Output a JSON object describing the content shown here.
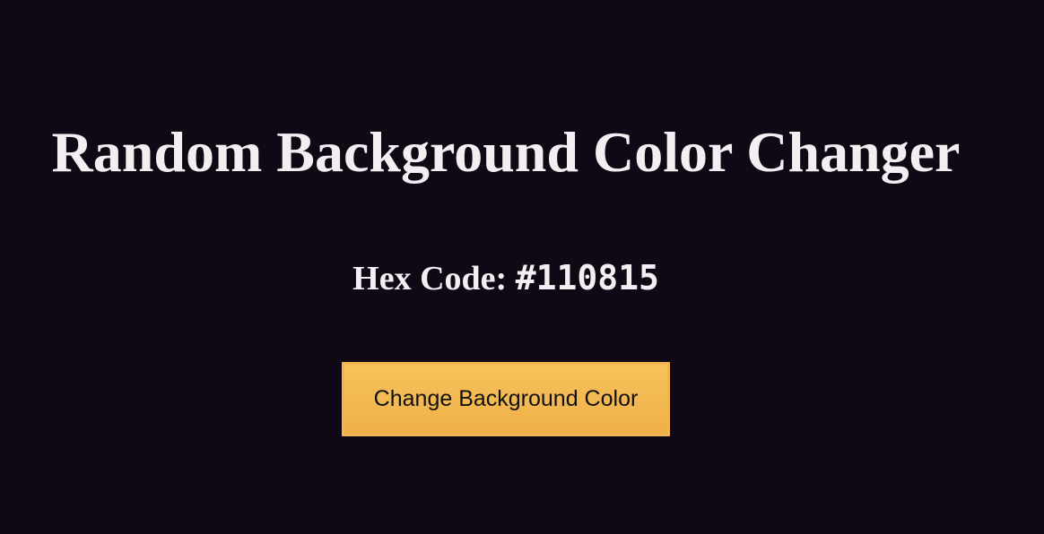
{
  "page": {
    "title": "Random Background Color Changer",
    "background_color": "#110815",
    "text_color": "#f2eef2"
  },
  "hex": {
    "label": "Hex Code:",
    "value": "#110815"
  },
  "button": {
    "label": "Change Background Color",
    "color": "#f4b650"
  }
}
